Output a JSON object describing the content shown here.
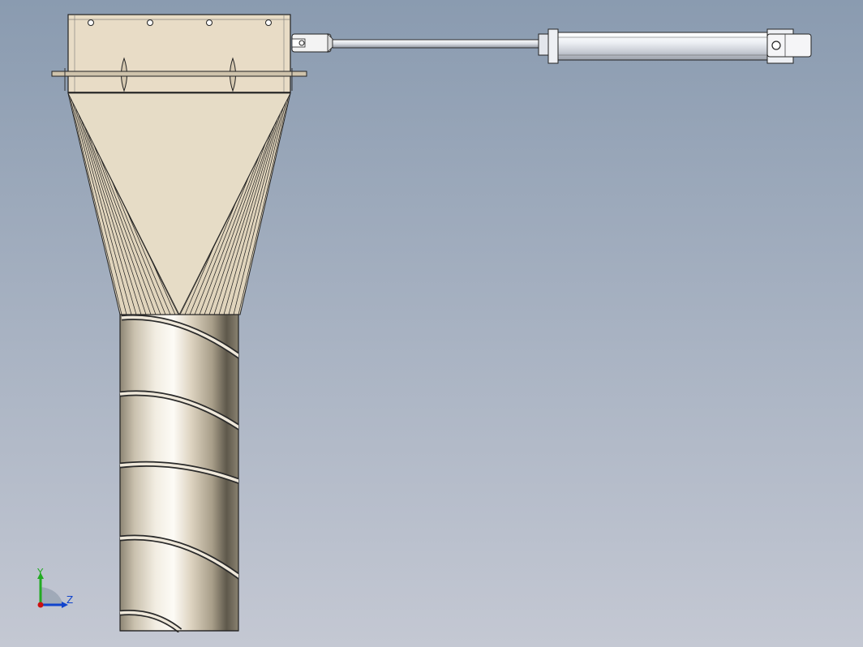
{
  "colors": {
    "background_top": "#8c9cb1",
    "background_bottom": "#c2c6d2",
    "part_beige": "#e3d7c0",
    "part_beige_light": "#ede3d0",
    "metal_light": "#f1ecdf",
    "metal_dark": "#6b6454",
    "cylinder_silver": "#e9ecf2",
    "outline": "#222222",
    "axis_x": "#cc1111",
    "axis_y": "#22aa22",
    "axis_z": "#1144cc"
  },
  "triad": {
    "y_label": "Y",
    "z_label": "Z"
  },
  "model": {
    "components": [
      "hopper-box",
      "funnel",
      "spiral-tube",
      "hydraulic-cylinder"
    ]
  }
}
